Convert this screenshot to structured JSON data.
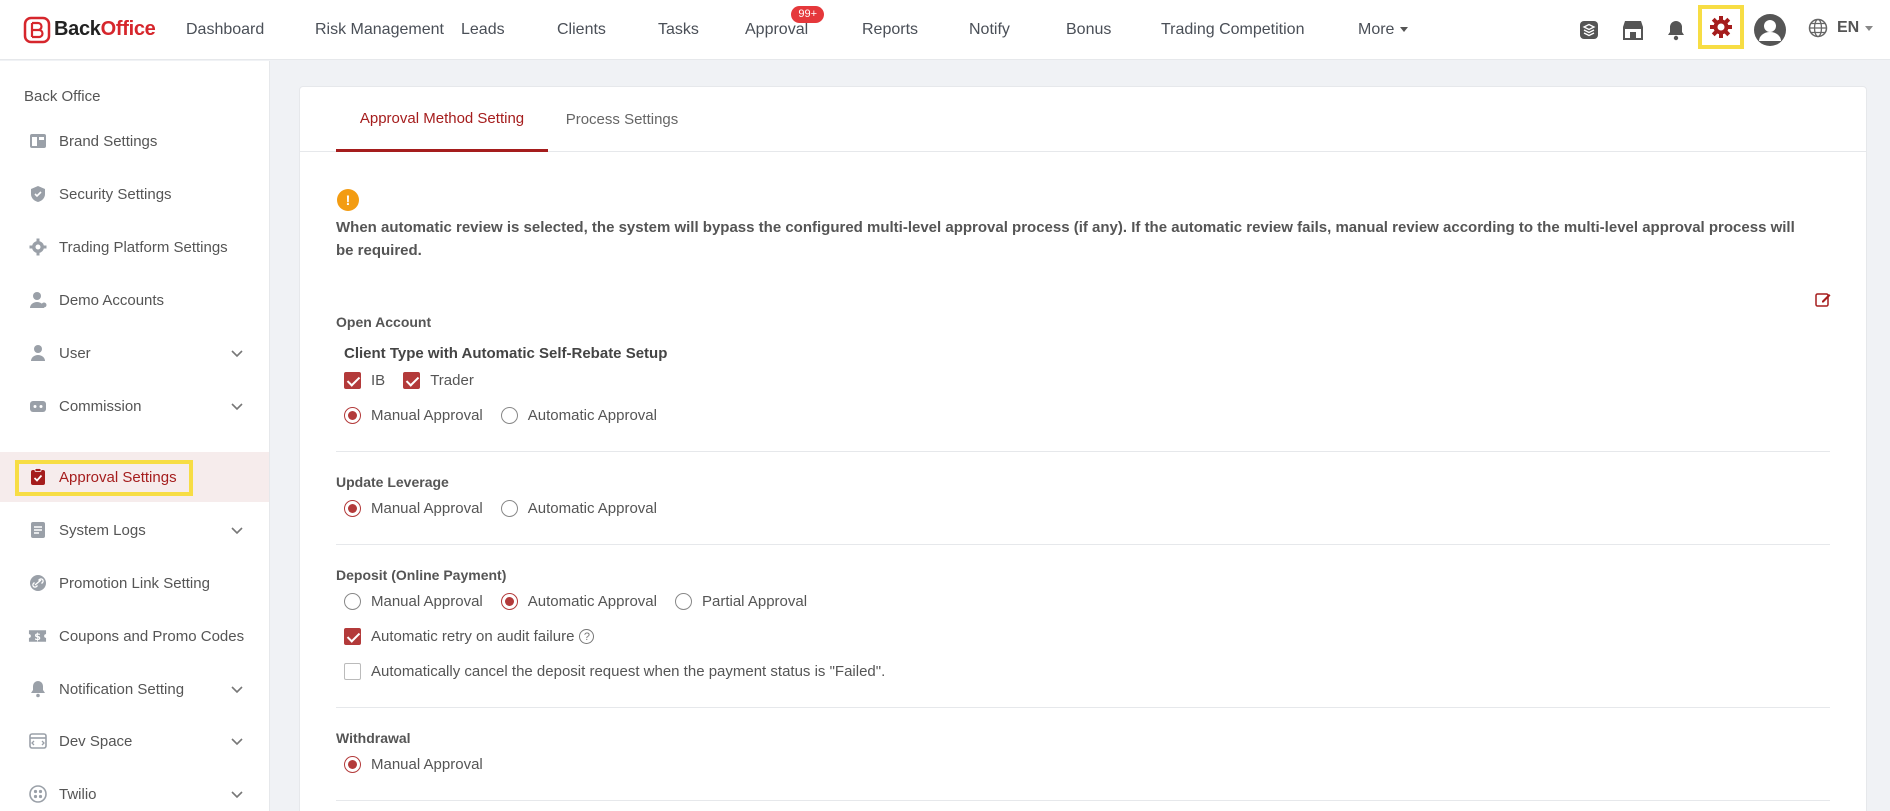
{
  "app": {
    "brand_part1": "Back",
    "brand_part2": "Office"
  },
  "colors": {
    "accent": "#a51d1d",
    "badge": "#e5383b",
    "highlight": "#f7dd44",
    "warning": "#f39c12"
  },
  "nav": {
    "items": [
      {
        "label": "Dashboard"
      },
      {
        "label": "Risk Management"
      },
      {
        "label": "Leads"
      },
      {
        "label": "Clients"
      },
      {
        "label": "Tasks"
      },
      {
        "label": "Approval",
        "badge": "99+"
      },
      {
        "label": "Reports"
      },
      {
        "label": "Notify"
      },
      {
        "label": "Bonus"
      },
      {
        "label": "Trading Competition"
      },
      {
        "label": "More"
      }
    ],
    "icons": [
      "layers-icon",
      "store-icon",
      "bell-icon",
      "settings-gear-icon",
      "user-avatar-icon",
      "globe-icon"
    ],
    "language": "EN"
  },
  "sidebar": {
    "title": "Back Office",
    "items": [
      {
        "label": "Brand Settings",
        "icon": "brand-icon",
        "expandable": false
      },
      {
        "label": "Security Settings",
        "icon": "shield-icon",
        "expandable": false
      },
      {
        "label": "Trading Platform Settings",
        "icon": "gear-icon",
        "expandable": false
      },
      {
        "label": "Demo Accounts",
        "icon": "user-account-icon",
        "expandable": false
      },
      {
        "label": "User",
        "icon": "user-icon",
        "expandable": true
      },
      {
        "label": "Commission",
        "icon": "commission-icon",
        "expandable": true
      },
      {
        "label": "Approval Settings",
        "icon": "clipboard-check-icon",
        "expandable": false,
        "active": true
      },
      {
        "label": "System Logs",
        "icon": "logs-icon",
        "expandable": true
      },
      {
        "label": "Promotion Link Setting",
        "icon": "link-icon",
        "expandable": false
      },
      {
        "label": "Coupons and Promo Codes",
        "icon": "coupon-icon",
        "expandable": false
      },
      {
        "label": "Notification Setting",
        "icon": "bell-icon",
        "expandable": true
      },
      {
        "label": "Dev Space",
        "icon": "dev-icon",
        "expandable": true
      },
      {
        "label": "Twilio",
        "icon": "twilio-icon",
        "expandable": true
      }
    ]
  },
  "main": {
    "tabs": [
      {
        "label": "Approval Method Setting",
        "active": true
      },
      {
        "label": "Process Settings",
        "active": false
      }
    ],
    "notice": "When automatic review is selected, the system will bypass the configured multi-level approval process (if any). If the automatic review fails, manual review according to the multi-level approval process will be required.",
    "sections": {
      "open_account": {
        "title": "Open Account",
        "subtitle": "Client Type with Automatic Self-Rebate Setup",
        "checks": [
          {
            "label": "IB",
            "checked": true
          },
          {
            "label": "Trader",
            "checked": true
          }
        ],
        "options": [
          {
            "label": "Manual Approval",
            "selected": true
          },
          {
            "label": "Automatic Approval",
            "selected": false
          }
        ]
      },
      "update_leverage": {
        "title": "Update Leverage",
        "options": [
          {
            "label": "Manual Approval",
            "selected": true
          },
          {
            "label": "Automatic Approval",
            "selected": false
          }
        ]
      },
      "deposit": {
        "title": "Deposit (Online Payment)",
        "options": [
          {
            "label": "Manual Approval",
            "selected": false
          },
          {
            "label": "Automatic Approval",
            "selected": true
          },
          {
            "label": "Partial Approval",
            "selected": false
          }
        ],
        "retry_label": "Automatic retry on audit failure",
        "retry_checked": true,
        "help_glyph": "?",
        "cancel_label": "Automatically cancel the deposit request when the payment status is \"Failed\".",
        "cancel_checked": false
      },
      "withdrawal": {
        "title": "Withdrawal",
        "options": [
          {
            "label": "Manual Approval",
            "selected": true
          }
        ]
      }
    }
  }
}
